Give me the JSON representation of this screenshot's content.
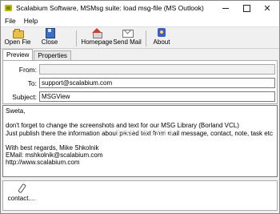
{
  "window": {
    "title": "Scalabium Software, MSMsg suite: load msg-file (MS Outlook)",
    "close_glyph": "✕"
  },
  "menu": [
    "File",
    "Help"
  ],
  "toolbar": {
    "open_label": "Open Fie",
    "close_label": "Close",
    "homepage_label": "Homepage",
    "sendmail_label": "Send Mail",
    "about_label": "About"
  },
  "tabs": [
    {
      "label": "Preview",
      "active": true
    },
    {
      "label": "Properties",
      "active": false
    }
  ],
  "fields": {
    "from_label": "From:",
    "from_value": "",
    "to_label": "To:",
    "to_value": "support@scalabium.com",
    "subject_label": "Subject:",
    "subject_value": "MSGView"
  },
  "body_lines": [
    "Sweta,",
    "",
    "don't forget to change the screenshots and text for our MSG Library (Borland VCL)",
    "Just publish there the information about parsed text from mail message, contact, note, task etc",
    "",
    "With best regards, Mike Shkolnik",
    "EMail: mshkolnik@scalabium.com",
    "http://www.scalabium.com"
  ],
  "attachment": {
    "label": "contact...."
  },
  "watermark": "SOFTPEDIA"
}
